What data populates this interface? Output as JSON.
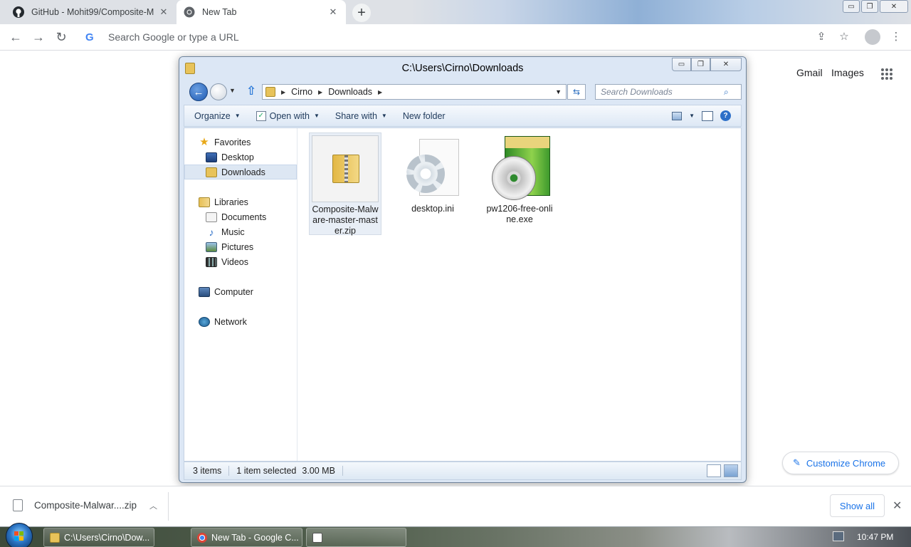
{
  "browser": {
    "tabs": [
      {
        "title": "GitHub - Mohit99/Composite-M",
        "close": "✕",
        "icon": "github-icon"
      },
      {
        "title": "New Tab",
        "close": "✕",
        "icon": "chrome-icon"
      }
    ],
    "new_tab": "+",
    "window_buttons": {
      "minimize": "▭",
      "restore": "❐",
      "close": "✕"
    },
    "omnibox_placeholder": "Search Google or type a URL",
    "ntp_links": [
      "Gmail",
      "Images"
    ],
    "customize_label": "Customize Chrome"
  },
  "explorer": {
    "title": "C:\\Users\\Cirno\\Downloads",
    "window_buttons": {
      "minimize": "▭",
      "restore": "❐",
      "close": "✕"
    },
    "breadcrumb": [
      "Cirno",
      "Downloads"
    ],
    "search_placeholder": "Search Downloads",
    "commands": {
      "organize": "Organize",
      "open_with": "Open with",
      "share_with": "Share with",
      "new_folder": "New folder"
    },
    "nav": {
      "favorites": "Favorites",
      "desktop": "Desktop",
      "downloads": "Downloads",
      "libraries": "Libraries",
      "documents": "Documents",
      "music": "Music",
      "pictures": "Pictures",
      "videos": "Videos",
      "computer": "Computer",
      "network": "Network"
    },
    "files": [
      {
        "name": "Composite-Malware-master-master.zip",
        "icon": "zip-folder-icon",
        "selected": true
      },
      {
        "name": "desktop.ini",
        "icon": "settings-file-icon",
        "selected": false
      },
      {
        "name": "pw1206-free-online.exe",
        "icon": "installer-icon",
        "selected": false
      }
    ],
    "status": {
      "count": "3 items",
      "selected": "1 item selected",
      "size": "3.00 MB"
    }
  },
  "downloads_shelf": {
    "item": "Composite-Malwar....zip",
    "show_all": "Show all"
  },
  "taskbar": {
    "buttons": [
      {
        "label": "C:\\Users\\Cirno\\Dow..."
      },
      {
        "label": "New Tab - Google C..."
      },
      {
        "label": ""
      }
    ],
    "clock": "10:47 PM"
  },
  "colors": {
    "chrome_accent": "#1a73e8",
    "explorer_frame": "#dce7f5",
    "selection": "#e8eef6"
  }
}
